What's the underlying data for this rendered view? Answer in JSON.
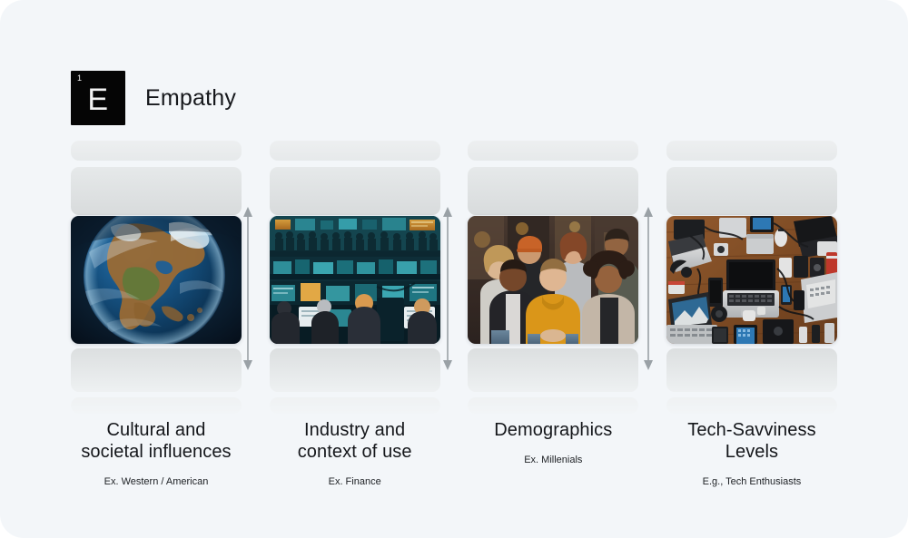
{
  "header": {
    "badge_index": "1",
    "badge_letter": "E",
    "title": "Empathy"
  },
  "arrows": {
    "icon": "double-arrow-vertical-icon",
    "color": "#9aa1a6",
    "count": 3
  },
  "columns": [
    {
      "id": "cultural-societal-influences",
      "title": "Cultural and\nsocietal influences",
      "subtitle": "Ex. Western / American",
      "image_name": "earth-from-space-north-america-image",
      "image_alt": "Planet Earth seen from space showing North America"
    },
    {
      "id": "industry-context-of-use",
      "title": "Industry and\ncontext of use",
      "subtitle": "Ex. Finance",
      "image_name": "finance-trading-floor-image",
      "image_alt": "Busy financial trading floor with many monitors"
    },
    {
      "id": "demographics",
      "title": "Demographics",
      "subtitle": "Ex. Millenials",
      "image_name": "diverse-young-people-group-image",
      "image_alt": "Group of diverse smiling young adults sitting together"
    },
    {
      "id": "tech-savviness-levels",
      "title": "Tech-Savviness\nLevels",
      "subtitle": "E.g., Tech Enthusiasts",
      "image_name": "tech-gadgets-flatlay-image",
      "image_alt": "Flat lay of laptops, tablets, phones and cables on a wooden desk"
    }
  ],
  "colors": {
    "page_background": "#f3f6f9",
    "outer_background": "#ffffff",
    "badge_background": "#050505",
    "badge_foreground": "#f2f2f2",
    "title_text": "#16181c",
    "caption_text": "#14161a",
    "subtitle_text": "#1d2024",
    "placeholder_slab": "#e0e3e4",
    "arrow": "#9aa1a6"
  }
}
